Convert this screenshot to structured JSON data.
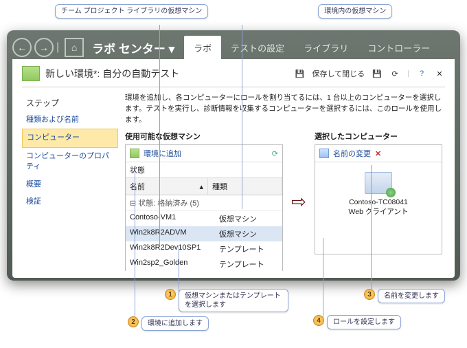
{
  "calloutTop1": "チーム プロジェクト ライブラリの仮想マシン",
  "calloutTop2": "環境内の仮想マシン",
  "appTitle": "ラボ センター",
  "tabs": {
    "lab": "ラボ",
    "testSettings": "テストの設定",
    "library": "ライブラリ",
    "controller": "コントローラー"
  },
  "docTitle": "新しい環境*: 自分の自動テスト",
  "saveClose": "保存して閉じる",
  "sidebar": {
    "header": "ステップ",
    "items": [
      "種類および名前",
      "コンピューター",
      "コンピューターのプロパティ",
      "概要",
      "検証"
    ],
    "selected": 1
  },
  "instruction": "環境を追加し、各コンピューターにロールを割り当てるには、1 台以上のコンピューターを選択します。テストを実行し、診断情報を収集するコンピューターを選択するには、このロールを使用します。",
  "left": {
    "head": "使用可能な仮想マシン",
    "addEnv": "環境に追加",
    "state": "状態",
    "colName": "名前",
    "colType": "種類",
    "group": "⊟ 状態: 格納済み (5)",
    "rows": [
      {
        "name": "Contoso-VM1",
        "type": "仮想マシン"
      },
      {
        "name": "Win2k8R2ADVM",
        "type": "仮想マシン"
      },
      {
        "name": "Win2k8R2Dev10SP1",
        "type": "テンプレート"
      },
      {
        "name": "Win2sp2_Golden",
        "type": "テンプレート"
      }
    ],
    "selectedRow": 1
  },
  "right": {
    "head": "選択したコンピューター",
    "rename": "名前の変更",
    "vmName": "Contoso-TC08041",
    "vmRole": "Web クライアント"
  },
  "annotations": {
    "a1": "仮想マシンまたはテンプレートを選択します",
    "a2": "環境に追加します",
    "a3": "名前を変更します",
    "a4": "ロールを設定します"
  }
}
